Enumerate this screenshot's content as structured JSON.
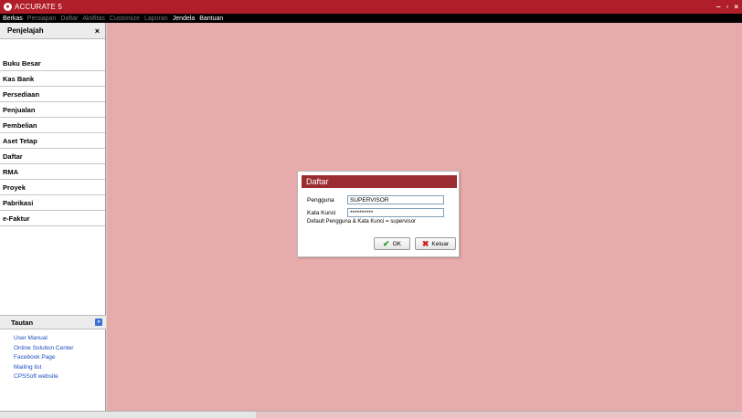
{
  "window": {
    "title": "ACCURATE 5",
    "min_label": "‒",
    "restore_label": "▫",
    "close_label": "×"
  },
  "colors": {
    "titlebar": "#b01e2a",
    "menubar": "#000000",
    "workspace": "#e8abab",
    "dialog_title": "#9b2d30",
    "link": "#1a4fbf"
  },
  "menu": {
    "items": [
      {
        "label": "Berkas",
        "enabled": true
      },
      {
        "label": "Persiapan",
        "enabled": false
      },
      {
        "label": "Daftar",
        "enabled": false
      },
      {
        "label": "Aktifitas",
        "enabled": false
      },
      {
        "label": "Customize",
        "enabled": false
      },
      {
        "label": "Laporan",
        "enabled": false
      },
      {
        "label": "Jendela",
        "enabled": true
      },
      {
        "label": "Bantuan",
        "enabled": true
      }
    ]
  },
  "sidebar": {
    "header": "Penjelajah",
    "close_label": "×",
    "items": [
      {
        "label": "Buku Besar"
      },
      {
        "label": "Kas Bank"
      },
      {
        "label": "Persediaan"
      },
      {
        "label": "Penjualan"
      },
      {
        "label": "Pembelian"
      },
      {
        "label": "Aset Tetap"
      },
      {
        "label": "Daftar"
      },
      {
        "label": "RMA"
      },
      {
        "label": "Proyek"
      },
      {
        "label": "Pabrikasi"
      },
      {
        "label": "e-Faktur"
      }
    ],
    "tautan": {
      "header": "Tautan",
      "chevron": "»",
      "links": [
        {
          "label": "User Manual"
        },
        {
          "label": "Online Solution Center"
        },
        {
          "label": "Facebook Page"
        },
        {
          "label": "Mailing list"
        },
        {
          "label": "CPSSoft website"
        }
      ]
    }
  },
  "dialog": {
    "title": "Daftar",
    "pengguna_label": "Pengguna",
    "pengguna_value": "SUPERVISOR",
    "kata_kunci_label": "Kata Kunci",
    "kata_kunci_value": "**********",
    "hint": "Default Pengguna & Kata Kunci = supervisor",
    "ok_label": "OK",
    "keluar_label": "Keluar"
  }
}
